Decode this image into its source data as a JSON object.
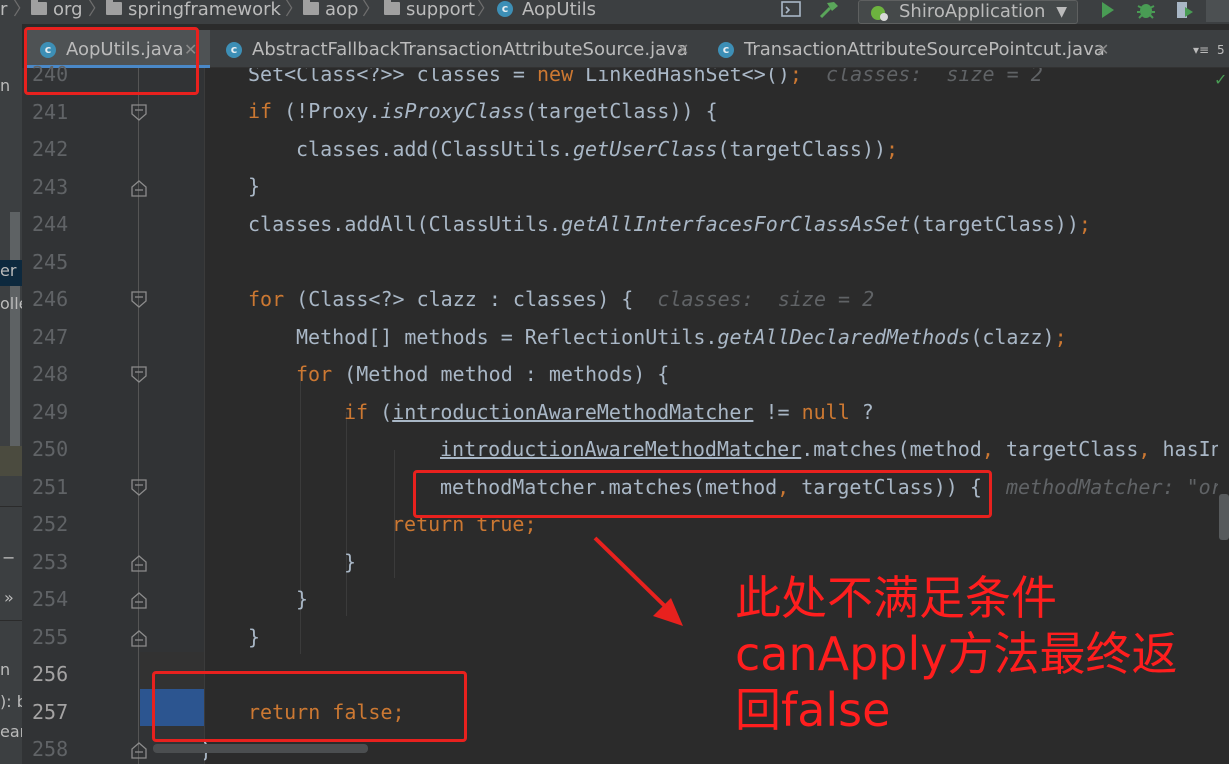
{
  "breadcrumb": {
    "items": [
      "r",
      "org",
      "springframework",
      "aop",
      "support",
      "AopUtils"
    ]
  },
  "toolbar": {
    "run_config": "ShiroApplication",
    "build_icon": "hammer-icon",
    "run_icon": "run-icon",
    "debug_icon": "debug-icon",
    "coverage_icon": "coverage-icon"
  },
  "tabs": [
    {
      "label": "AopUtils.java",
      "active": true
    },
    {
      "label": "AbstractFallbackTransactionAttributeSource.java",
      "active": false
    },
    {
      "label": "TransactionAttributeSourcePointcut.java",
      "active": false
    }
  ],
  "tab_overflow": "5",
  "left_panel": {
    "fragments": [
      "n",
      "er",
      "olle",
      "n",
      "): b",
      "ean"
    ],
    "expander": "»",
    "minus": "−"
  },
  "code": {
    "line_numbers": [
      "240",
      "241",
      "242",
      "243",
      "244",
      "245",
      "246",
      "247",
      "248",
      "249",
      "250",
      "251",
      "252",
      "253",
      "254",
      "255",
      "256",
      "257",
      "258"
    ],
    "l240": {
      "a": "Set<Class<?>> classes = ",
      "kw": "new",
      "b": " LinkedHashSet<>()",
      "semi": ";",
      "hint": "classes:  size = 2"
    },
    "l241": {
      "kw": "if",
      "a": " (!Proxy.",
      "it": "isProxyClass",
      "b": "(targetClass)) {"
    },
    "l242": {
      "a": "classes.add(ClassUtils.",
      "it": "getUserClass",
      "b": "(targetClass))",
      "semi": ";"
    },
    "l243": {
      "a": "}"
    },
    "l244": {
      "a": "classes.addAll(ClassUtils.",
      "it": "getAllInterfacesForClassAsSet",
      "b": "(targetClass))",
      "semi": ";"
    },
    "l246": {
      "kw": "for",
      "a": " (Class<?> clazz : classes) {",
      "hint": "classes:  size = 2"
    },
    "l247": {
      "a": "Method[] methods = ReflectionUtils.",
      "it": "getAllDeclaredMethods",
      "b": "(clazz)",
      "semi": ";"
    },
    "l248": {
      "kw": "for",
      "a": " (Method method : methods) {"
    },
    "l249": {
      "kw": "if",
      "a": " (",
      "ul": "introductionAwareMethodMatcher",
      "b": " != ",
      "kw2": "null",
      "c": " ?"
    },
    "l250": {
      "ul": "introductionAwareMethodMatcher",
      "a": ".matches(method",
      "comma": ",",
      "b": " targetClass",
      "comma2": ",",
      "c": " hasInt"
    },
    "l251": {
      "a": "methodMatcher.matches(method",
      "comma": ",",
      "b": " targetClass)) {",
      "hint": "methodMatcher: \"org"
    },
    "l252": {
      "kw": "return",
      "kw2": "true",
      "semi": ";"
    },
    "l253": {
      "a": "}"
    },
    "l254": {
      "a": "}"
    },
    "l255": {
      "a": "}"
    },
    "l257": {
      "kw": "return",
      "kw2": "false",
      "semi": ";"
    },
    "l258": {
      "a": "}"
    }
  },
  "annotation": {
    "lines": [
      "此处不满足条件",
      "canApply方法最终返",
      "回false"
    ]
  },
  "colors": {
    "keyword": "#cc7832",
    "text": "#a9b7c6",
    "highlight": "#2c5590",
    "annotation": "#ff1e1e"
  }
}
